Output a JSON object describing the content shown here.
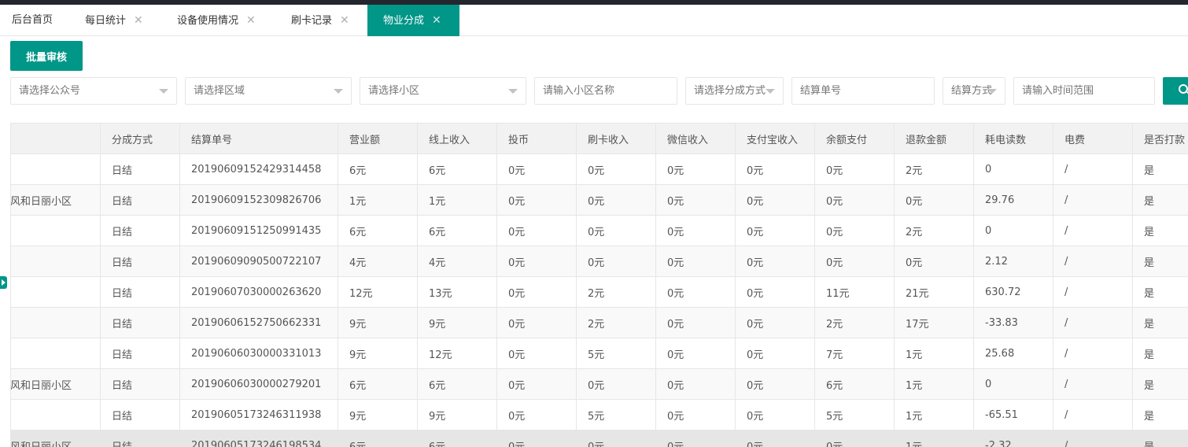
{
  "tabs": [
    {
      "label": "后台首页",
      "closable": false,
      "active": false
    },
    {
      "label": "每日统计",
      "closable": true,
      "active": false
    },
    {
      "label": "设备使用情况",
      "closable": true,
      "active": false
    },
    {
      "label": "刷卡记录",
      "closable": true,
      "active": false
    },
    {
      "label": "物业分成",
      "closable": true,
      "active": true
    }
  ],
  "close_glyph": "✕",
  "toolbar": {
    "batch_review_label": "批量审核"
  },
  "filters": {
    "official_account": "请选择公众号",
    "region": "请选择区域",
    "community": "请选择小区",
    "community_name": "请输入小区名称",
    "split_method": "请选择分成方式",
    "settlement_no": "结算单号",
    "settlement_method": "结算方式",
    "time_range": "请输入时间范围"
  },
  "icons": {
    "search": "search-icon",
    "dropdown": "chevron-down-icon",
    "sidebar_toggle": "triangle-right-icon"
  },
  "colors": {
    "accent": "#009688",
    "header_bg": "#f2f2f2",
    "topbar": "#23262e"
  },
  "table": {
    "columns": [
      "",
      "分成方式",
      "结算单号",
      "营业额",
      "线上收入",
      "投币",
      "刷卡收入",
      "微信收入",
      "支付宝收入",
      "余额支付",
      "退款金额",
      "耗电读数",
      "电费",
      "是否打款"
    ],
    "rows": [
      [
        "",
        "日结",
        "20190609152429314458",
        "6元",
        "6元",
        "0元",
        "0元",
        "0元",
        "0元",
        "0元",
        "2元",
        "0",
        "/",
        "是"
      ],
      [
        "春风和日丽小区",
        "日结",
        "20190609152309826706",
        "1元",
        "1元",
        "0元",
        "0元",
        "0元",
        "0元",
        "0元",
        "0元",
        "29.76",
        "/",
        "是"
      ],
      [
        "",
        "日结",
        "20190609151250991435",
        "6元",
        "6元",
        "0元",
        "0元",
        "0元",
        "0元",
        "0元",
        "2元",
        "0",
        "/",
        "是"
      ],
      [
        "",
        "日结",
        "20190609090500722107",
        "4元",
        "4元",
        "0元",
        "0元",
        "0元",
        "0元",
        "0元",
        "0元",
        "2.12",
        "/",
        "是"
      ],
      [
        "",
        "日结",
        "20190607030000263620",
        "12元",
        "13元",
        "0元",
        "2元",
        "0元",
        "0元",
        "11元",
        "21元",
        "630.72",
        "/",
        "是"
      ],
      [
        "",
        "日结",
        "20190606152750662331",
        "9元",
        "9元",
        "0元",
        "2元",
        "0元",
        "0元",
        "2元",
        "17元",
        "-33.83",
        "/",
        "是"
      ],
      [
        "",
        "日结",
        "20190606030000331013",
        "9元",
        "12元",
        "0元",
        "5元",
        "0元",
        "0元",
        "7元",
        "1元",
        "25.68",
        "/",
        "是"
      ],
      [
        "春风和日丽小区",
        "日结",
        "20190606030000279201",
        "6元",
        "6元",
        "0元",
        "0元",
        "0元",
        "0元",
        "6元",
        "1元",
        "0",
        "/",
        "是"
      ],
      [
        "",
        "日结",
        "20190605173246311938",
        "9元",
        "9元",
        "0元",
        "5元",
        "0元",
        "0元",
        "5元",
        "1元",
        "-65.51",
        "/",
        "是"
      ],
      [
        "春风和日丽小区",
        "日结",
        "20190605173246198534",
        "6元",
        "6元",
        "0元",
        "0元",
        "0元",
        "0元",
        "0元",
        "1元",
        "-2.32",
        "/",
        "是"
      ]
    ]
  }
}
